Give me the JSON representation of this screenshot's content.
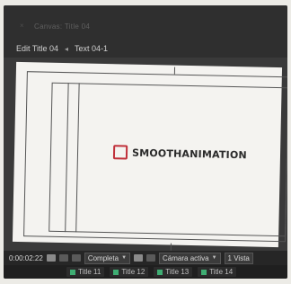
{
  "panel": {
    "title": "Canvas: Title 04",
    "close_glyph": "×"
  },
  "breadcrumb": {
    "items": [
      "Edit Title 04",
      "Text 04-1"
    ],
    "separator": "◂"
  },
  "logo": {
    "text": "SMOOTHANIMATION",
    "accent_color": "#c0303a",
    "icon": "square-outline-icon"
  },
  "controls": {
    "timecode": "0:00:02:22",
    "resolution": "Completa",
    "camera": "Cámara activa",
    "view": "1 Vista",
    "icons": [
      "camera-icon",
      "channels-icon",
      "color-icon",
      "region-icon",
      "transparency-grid-icon"
    ]
  },
  "tabs": [
    {
      "label": "Title 11",
      "color": "#3fae73"
    },
    {
      "label": "Title 12",
      "color": "#3fae73"
    },
    {
      "label": "Title 13",
      "color": "#3fae73"
    },
    {
      "label": "Title 14",
      "color": "#3fae73"
    }
  ]
}
